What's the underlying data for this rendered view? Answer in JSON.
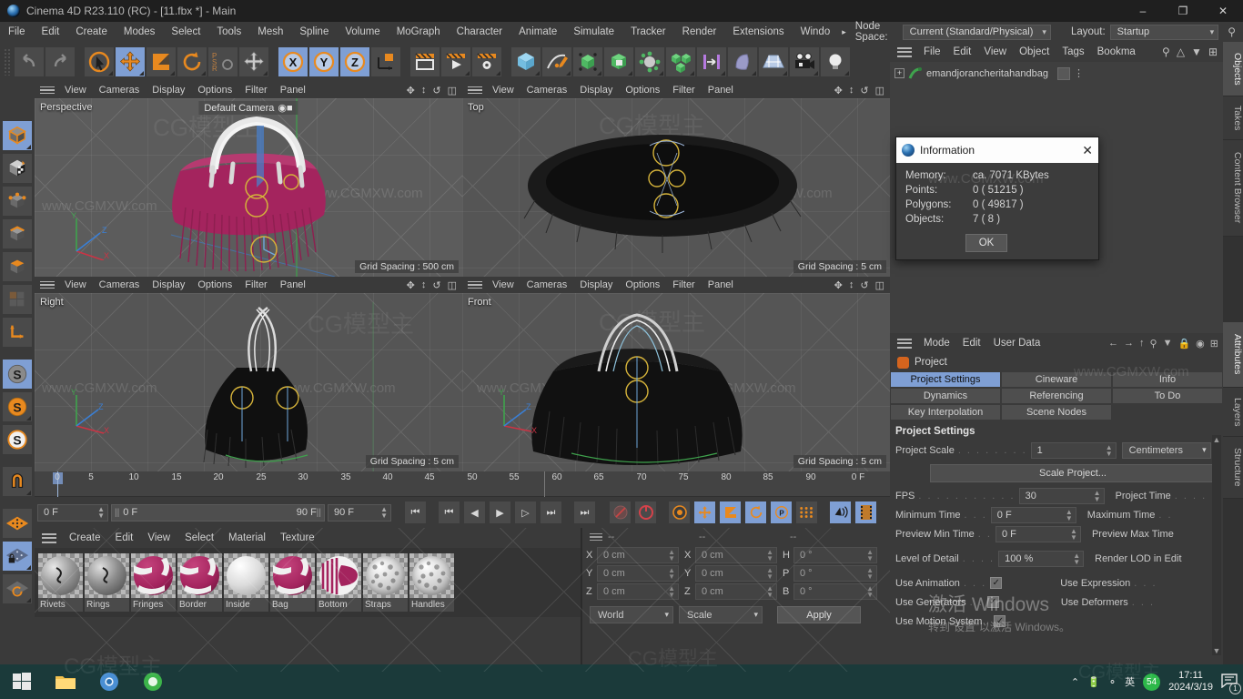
{
  "window": {
    "title": "Cinema 4D R23.110 (RC) - [11.fbx *] - Main",
    "minimize": "–",
    "maximize": "❐",
    "close": "✕"
  },
  "menubar": {
    "items": [
      "File",
      "Edit",
      "Create",
      "Modes",
      "Select",
      "Tools",
      "Mesh",
      "Spline",
      "Volume",
      "MoGraph",
      "Character",
      "Animate",
      "Simulate",
      "Tracker",
      "Render",
      "Extensions",
      "Windo"
    ],
    "overflow_arrow": "▸",
    "node_space_label": "Node Space:",
    "node_space_value": "Current (Standard/Physical)",
    "layout_label": "Layout:",
    "layout_value": "Startup",
    "search_icon": "⚲"
  },
  "toolbar": {
    "groups": [
      {
        "name": "history",
        "buttons": [
          {
            "name": "undo-button",
            "glyph": "↶",
            "active": false
          },
          {
            "name": "redo-button",
            "glyph": "↷",
            "active": false
          }
        ]
      },
      {
        "name": "transform",
        "buttons": [
          {
            "name": "select-tool-button",
            "glyph": "➤",
            "active": false
          },
          {
            "name": "move-tool-button",
            "glyph": "✤",
            "active": true
          },
          {
            "name": "scale-tool-button",
            "glyph": "◨",
            "active": false
          },
          {
            "name": "rotate-tool-button",
            "glyph": "↺",
            "active": false
          },
          {
            "name": "psr-button",
            "glyph": "PSR",
            "active": false
          },
          {
            "name": "world-axis-button",
            "glyph": "✤",
            "active": false
          }
        ]
      },
      {
        "name": "axis-lock",
        "buttons": [
          {
            "name": "lock-x-button",
            "glyph": "X",
            "active": true
          },
          {
            "name": "lock-y-button",
            "glyph": "Y",
            "active": true
          },
          {
            "name": "lock-z-button",
            "glyph": "Z",
            "active": true
          },
          {
            "name": "coordinate-system-button",
            "glyph": "⟳",
            "active": false
          }
        ]
      },
      {
        "name": "render",
        "buttons": [
          {
            "name": "render-view-button",
            "glyph": "▭",
            "active": false
          },
          {
            "name": "render-region-button",
            "glyph": "▶",
            "active": false
          },
          {
            "name": "render-settings-button",
            "glyph": "⚙",
            "active": false
          }
        ]
      },
      {
        "name": "create",
        "buttons": [
          {
            "name": "cube-primitive-button",
            "glyph": "⬛",
            "active": false
          },
          {
            "name": "spline-pen-button",
            "glyph": "✒",
            "active": false
          },
          {
            "name": "generator-button",
            "glyph": "⬚",
            "active": false
          },
          {
            "name": "subdivision-button",
            "glyph": "▣",
            "active": false
          },
          {
            "name": "deformer-button",
            "glyph": "✣",
            "active": false
          },
          {
            "name": "mograph-button",
            "glyph": "⬜",
            "active": false
          },
          {
            "name": "field-button",
            "glyph": "⊢",
            "active": false
          },
          {
            "name": "volume-button",
            "glyph": "◖",
            "active": false
          },
          {
            "name": "scene-button",
            "glyph": "▦",
            "active": false
          },
          {
            "name": "camera-button",
            "glyph": "◳",
            "active": false
          },
          {
            "name": "light-button",
            "glyph": "☀",
            "active": false
          }
        ]
      }
    ]
  },
  "left_toolbar": {
    "buttons": [
      {
        "name": "model-mode-button",
        "glyph": "⬛",
        "active": true
      },
      {
        "name": "texture-mode-button",
        "glyph": "▩",
        "active": false
      },
      {
        "name": "points-mode-button",
        "glyph": "●",
        "active": false
      },
      {
        "name": "edges-mode-button",
        "glyph": "▬",
        "active": false
      },
      {
        "name": "polygons-mode-button",
        "glyph": "▰",
        "active": false
      },
      {
        "name": "uv-mode-button",
        "glyph": "▦",
        "active": false
      },
      {
        "name": "axis-mode-button",
        "glyph": "┗",
        "active": false
      },
      {
        "name": "enable-axis-button",
        "glyph": "S",
        "active": true
      },
      {
        "name": "object-axis-button",
        "glyph": "S",
        "active": false
      },
      {
        "name": "texture-axis-button",
        "glyph": "S",
        "active": false
      },
      {
        "name": "snap-button",
        "glyph": "⚓",
        "active": false
      },
      {
        "name": "workplane-button",
        "glyph": "◰",
        "active": false
      },
      {
        "name": "lock-workplane-button",
        "glyph": "ὑ2",
        "active": true
      },
      {
        "name": "planar-workplane-button",
        "glyph": "↺",
        "active": false
      }
    ]
  },
  "viewports": {
    "menu_items": [
      "View",
      "Cameras",
      "Display",
      "Options",
      "Filter",
      "Panel"
    ],
    "header_icons": [
      "pan-icon",
      "dolly-icon",
      "rotate-icon",
      "maximize-icon"
    ],
    "panels": [
      {
        "name": "perspective-viewport",
        "label": "Perspective",
        "camera": "Default Camera",
        "grid_spacing": "Grid Spacing : 500 cm"
      },
      {
        "name": "top-viewport",
        "label": "Top",
        "camera": "",
        "grid_spacing": "Grid Spacing : 5 cm"
      },
      {
        "name": "right-viewport",
        "label": "Right",
        "camera": "",
        "grid_spacing": "Grid Spacing : 5 cm"
      },
      {
        "name": "front-viewport",
        "label": "Front",
        "camera": "",
        "grid_spacing": "Grid Spacing : 5 cm"
      }
    ]
  },
  "timeline": {
    "ticks": [
      "0",
      "5",
      "10",
      "15",
      "20",
      "25",
      "30",
      "35",
      "40",
      "45",
      "50",
      "55",
      "60",
      "65",
      "70",
      "75",
      "80",
      "85",
      "90"
    ],
    "current_frame": "0 F",
    "range_start": "0 F",
    "range_end": "90 F",
    "end_frame": "90 F",
    "trailing_frame": "0 F",
    "controls": [
      {
        "name": "go-to-start-button",
        "glyph": "⏮",
        "active": false
      },
      {
        "name": "go-to-previous-key-button",
        "glyph": "⏮",
        "active": false
      },
      {
        "name": "step-back-button",
        "glyph": "◀",
        "active": false
      },
      {
        "name": "play-button",
        "glyph": "▶",
        "active": false
      },
      {
        "name": "step-forward-button",
        "glyph": "▷",
        "active": false
      },
      {
        "name": "go-to-next-key-button",
        "glyph": "⏭",
        "active": false
      },
      {
        "name": "go-to-end-button",
        "glyph": "⏭",
        "active": false
      },
      {
        "name": "record-active-objects-button",
        "glyph": "◉",
        "active": false
      },
      {
        "name": "autokeying-button",
        "glyph": "○",
        "active": false
      },
      {
        "name": "keyframe-selection-button",
        "glyph": "⚙",
        "active": false
      },
      {
        "name": "position-key-button",
        "glyph": "✤",
        "active": true
      },
      {
        "name": "scale-key-button",
        "glyph": "◨",
        "active": true
      },
      {
        "name": "rotation-key-button",
        "glyph": "↺",
        "active": true
      },
      {
        "name": "param-key-button",
        "glyph": "P",
        "active": true
      },
      {
        "name": "point-level-anim-button",
        "glyph": "⁙",
        "active": false
      },
      {
        "name": "sound-button",
        "glyph": "♪",
        "active": true
      },
      {
        "name": "frame-button",
        "glyph": "▓",
        "active": true
      }
    ]
  },
  "material_manager": {
    "menu_items": [
      "Create",
      "Edit",
      "View",
      "Select",
      "Material",
      "Texture"
    ],
    "materials": [
      {
        "name": "Rivets",
        "color": "#9b9b9b",
        "type": "solid"
      },
      {
        "name": "Rings",
        "color": "#8e8e8e",
        "type": "solid"
      },
      {
        "name": "Fringes",
        "color": "#a4245e",
        "type": "pattern"
      },
      {
        "name": "Border",
        "color": "#a4245e",
        "type": "pattern"
      },
      {
        "name": "Inside",
        "color": "#dcdcdc",
        "type": "solid"
      },
      {
        "name": "Bag",
        "color": "#a4245e",
        "type": "pattern"
      },
      {
        "name": "Bottom",
        "color": "#a4245e",
        "type": "stripes"
      },
      {
        "name": "Straps",
        "color": "#d8d8d8",
        "type": "rough"
      },
      {
        "name": "Handles",
        "color": "#d8d8d8",
        "type": "rough"
      }
    ]
  },
  "coordinates": {
    "header_dashes": [
      "--",
      "--",
      "--"
    ],
    "position": {
      "label_x": "X",
      "label_y": "Y",
      "label_z": "Z",
      "x": "0 cm",
      "y": "0 cm",
      "z": "0 cm"
    },
    "size": {
      "label_x": "X",
      "label_y": "Y",
      "label_z": "Z",
      "x": "0 cm",
      "y": "0 cm",
      "z": "0 cm"
    },
    "rotation": {
      "label_h": "H",
      "label_p": "P",
      "label_b": "B",
      "h": "0 °",
      "p": "0 °",
      "b": "0 °"
    },
    "system": "World",
    "mode": "Scale",
    "apply": "Apply"
  },
  "object_manager": {
    "menu_items": [
      "File",
      "Edit",
      "View",
      "Object",
      "Tags",
      "Bookma"
    ],
    "icons": [
      "search-icon",
      "home-icon",
      "filter-icon",
      "add-icon"
    ],
    "objects": [
      {
        "name": "emandjorancheritahandbag",
        "expand": "+",
        "dots": "⋮"
      }
    ]
  },
  "attribute_manager": {
    "menu_items": [
      "Mode",
      "Edit",
      "User Data"
    ],
    "icons": [
      "back-icon",
      "forward-icon",
      "up-icon",
      "search-icon",
      "filter-icon",
      "lock-icon",
      "target-icon",
      "add-icon"
    ],
    "object_title": "Project",
    "tabs": [
      [
        "Project Settings",
        "Cineware",
        "Info"
      ],
      [
        "Dynamics",
        "Referencing",
        "To Do"
      ],
      [
        "Key Interpolation",
        "Scene Nodes",
        ""
      ]
    ],
    "selected_tab": "Project Settings",
    "section_title": "Project Settings",
    "project_scale": {
      "label": "Project Scale",
      "value": "1",
      "unit": "Centimeters"
    },
    "scale_project_button": "Scale Project...",
    "rows": [
      {
        "label": "FPS",
        "value": "30",
        "right_label": "Project Time",
        "type": "field"
      },
      {
        "label": "Minimum Time",
        "value": "0 F",
        "right_label": "Maximum Time",
        "type": "field"
      },
      {
        "label": "Preview Min Time",
        "value": "0 F",
        "right_label": "Preview Max Time",
        "type": "field"
      },
      {
        "label": "Level of Detail",
        "value": "100 %",
        "right_label": "Render LOD in Edit",
        "type": "field"
      },
      {
        "label": "Use Animation",
        "value": "✓",
        "right_label": "Use Expression",
        "type": "check"
      },
      {
        "label": "Use Generators",
        "value": "✓",
        "right_label": "Use Deformers",
        "type": "check"
      },
      {
        "label": "Use Motion System",
        "value": "✓",
        "right_label": "",
        "type": "check"
      }
    ]
  },
  "right_tabs": [
    {
      "label": "Objects",
      "selected": true
    },
    {
      "label": "Takes",
      "selected": false
    },
    {
      "label": "Content Browser",
      "selected": false
    },
    {
      "label": "Attributes",
      "selected": true
    },
    {
      "label": "Layers",
      "selected": false
    },
    {
      "label": "Structure",
      "selected": false
    }
  ],
  "information_dialog": {
    "title": "Information",
    "close": "✕",
    "rows": [
      {
        "key": "Memory:",
        "value": "ca. 7071 KBytes"
      },
      {
        "key": "Points:",
        "value": "0 ( 51215 )"
      },
      {
        "key": "Polygons:",
        "value": "0 ( 49817 )"
      },
      {
        "key": "Objects:",
        "value": "7 ( 8 )"
      }
    ],
    "ok": "OK"
  },
  "taskbar": {
    "start_icon": "windows-icon",
    "apps": [
      "file-explorer-icon",
      "chrome-icon",
      "browser-icon"
    ],
    "tray": [
      "chevron-up-icon",
      "battery-icon",
      "wifi-icon"
    ],
    "ime": "英",
    "badge": "54",
    "time": "17:11",
    "date": "2024/3/19",
    "notification_count": "1"
  },
  "watermarks": {
    "site": "www.CGMXW.com",
    "brand": "CG模型主",
    "windows_activation_line1": "激活 Windows",
    "windows_activation_line2": "转到“设置”以激活 Windows。"
  }
}
